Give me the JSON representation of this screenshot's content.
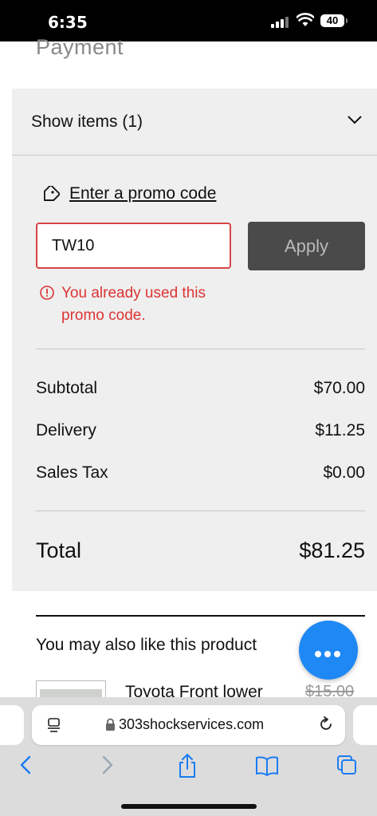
{
  "status_bar": {
    "time": "6:35",
    "battery": "40"
  },
  "page": {
    "title": "Payment"
  },
  "summary": {
    "show_items_label": "Show items (1)",
    "promo_link": "Enter a promo code",
    "promo_value": "TW10",
    "apply_label": "Apply",
    "error_message": "You already used this promo code.",
    "rows": [
      {
        "label": "Subtotal",
        "value": "$70.00"
      },
      {
        "label": "Delivery",
        "value": "$11.25"
      },
      {
        "label": "Sales Tax",
        "value": "$0.00"
      }
    ],
    "total": {
      "label": "Total",
      "value": "$81.25"
    }
  },
  "upsell": {
    "title": "You may also like this product",
    "product_name": "Toyota Front lower",
    "product_price": "$15.00"
  },
  "browser": {
    "url": "303shockservices.com"
  },
  "colors": {
    "error": "#d33333",
    "fab": "#1e88f5",
    "apply_bg": "#4a4a4a"
  }
}
